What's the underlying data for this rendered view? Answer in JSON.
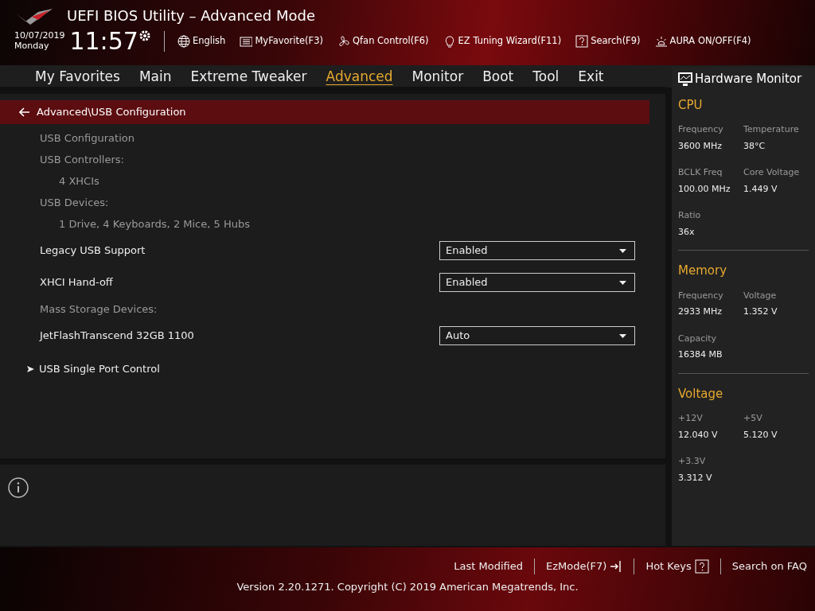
{
  "window": {
    "title": "UEFI BIOS Utility – Advanced Mode"
  },
  "header": {
    "date": "10/07/2019",
    "day": "Monday",
    "time": "11:57",
    "toolbar": [
      {
        "kind": "globe",
        "label": "English"
      },
      {
        "kind": "list",
        "label": "MyFavorite(F3)"
      },
      {
        "kind": "fan",
        "label": "Qfan Control(F6)"
      },
      {
        "kind": "bulb",
        "label": "EZ Tuning Wizard(F11)"
      },
      {
        "kind": "question",
        "label": "Search(F9)"
      },
      {
        "kind": "aura",
        "label": "AURA ON/OFF(F4)"
      }
    ]
  },
  "tabs": [
    {
      "label": "My Favorites",
      "selected": false
    },
    {
      "label": "Main",
      "selected": false
    },
    {
      "label": "Extreme Tweaker",
      "selected": false
    },
    {
      "label": "Advanced",
      "selected": true
    },
    {
      "label": "Monitor",
      "selected": false
    },
    {
      "label": "Boot",
      "selected": false
    },
    {
      "label": "Tool",
      "selected": false
    },
    {
      "label": "Exit",
      "selected": false
    }
  ],
  "breadcrumb": "Advanced\\USB Configuration",
  "items": [
    {
      "kind": "label",
      "label": "USB Configuration"
    },
    {
      "kind": "label",
      "label": "USB Controllers:"
    },
    {
      "kind": "info",
      "label": "4 XHCIs"
    },
    {
      "kind": "label",
      "label": "USB Devices:"
    },
    {
      "kind": "info",
      "label": "1 Drive, 4 Keyboards, 2 Mice, 5 Hubs"
    },
    {
      "kind": "setting",
      "label": "Legacy USB Support",
      "value": "Enabled"
    },
    {
      "kind": "setting",
      "label": "XHCI Hand-off",
      "value": "Enabled"
    },
    {
      "kind": "label",
      "label": "Mass Storage Devices:"
    },
    {
      "kind": "setting",
      "label": "JetFlashTranscend 32GB 1100",
      "value": "Auto"
    },
    {
      "kind": "submenu",
      "label": "USB Single Port Control"
    }
  ],
  "hardware_monitor": {
    "title": "Hardware Monitor",
    "sections": [
      {
        "title": "CPU",
        "readings": [
          {
            "label": "Frequency",
            "value": "3600 MHz"
          },
          {
            "label": "Temperature",
            "value": "38°C"
          },
          {
            "label": "BCLK Freq",
            "value": "100.00 MHz"
          },
          {
            "label": "Core Voltage",
            "value": "1.449 V"
          },
          {
            "label": "Ratio",
            "value": "36x"
          }
        ]
      },
      {
        "title": "Memory",
        "readings": [
          {
            "label": "Frequency",
            "value": "2933 MHz"
          },
          {
            "label": "Voltage",
            "value": "1.352 V"
          },
          {
            "label": "Capacity",
            "value": "16384 MB"
          }
        ]
      },
      {
        "title": "Voltage",
        "readings": [
          {
            "label": "+12V",
            "value": "12.040 V"
          },
          {
            "label": "+5V",
            "value": "5.120 V"
          },
          {
            "label": "+3.3V",
            "value": "3.312 V"
          }
        ]
      }
    ]
  },
  "footer": {
    "links": [
      {
        "kind": "plain",
        "label": "Last Modified"
      },
      {
        "kind": "exit",
        "label": "EzMode(F7)"
      },
      {
        "kind": "help",
        "label": "Hot Keys"
      },
      {
        "kind": "plain",
        "label": "Search on FAQ"
      }
    ],
    "copyright": "Version 2.20.1271. Copyright (C) 2019 American Megatrends, Inc."
  }
}
